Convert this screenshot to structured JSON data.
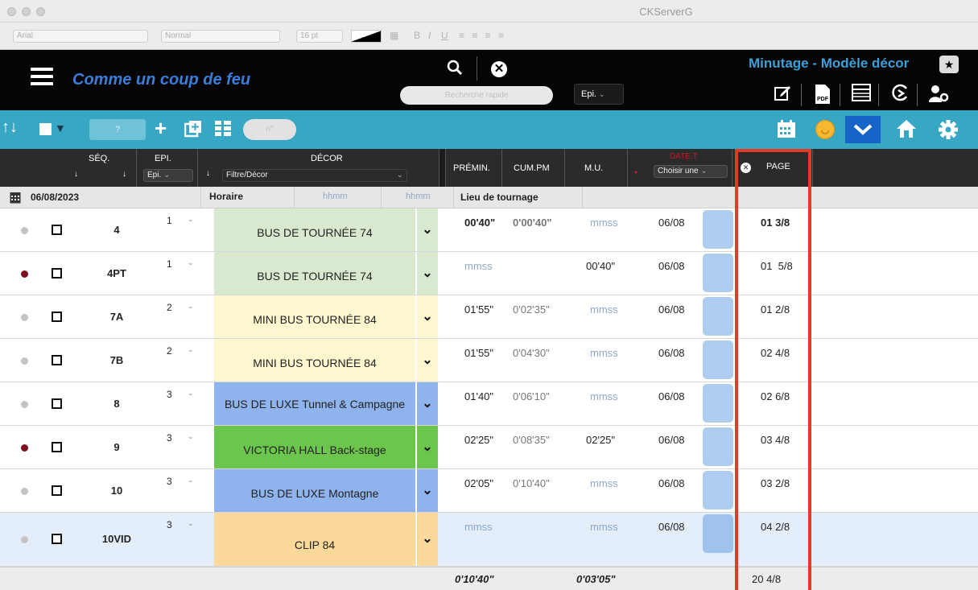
{
  "window": {
    "title": "CKServerG"
  },
  "format_bar": {
    "font": "Arial",
    "style": "Normal",
    "size": "16 pt",
    "bold": "B",
    "italic": "I",
    "underline": "U",
    "align_glyphs": "≡ ≡ ≡ ≡"
  },
  "header": {
    "app_title": "Comme un coup de feu",
    "search_placeholder": "Recherche rapide",
    "epi_select": "Epi.",
    "minutage_title": "Minutage - Modèle décor",
    "icons": [
      "edit-icon",
      "pdf-icon",
      "table-icon",
      "search-refresh-icon",
      "user-settings-icon"
    ],
    "pdf_label": "PDF"
  },
  "toolbar": {
    "number_input": "?",
    "pill_placeholder": "n°",
    "colors": {
      "bar": "#37a7c4",
      "accent_button": "#1664c8"
    }
  },
  "columns": {
    "seq": "SÉQ.",
    "epi": "EPI.",
    "epi_select": "Epi.",
    "decor": "DÉCOR",
    "decor_filter": "Filtre/Décor",
    "premin": "PRÉMIN.",
    "cumpm": "CUM.PM",
    "mu": "M.U.",
    "datet": "DATE.T",
    "datet_select": "Choisir une",
    "page": "PAGE"
  },
  "date_row": {
    "date": "06/08/2023",
    "horaire": "Horaire",
    "hhmm1": "hhmm",
    "hhmm2": "hhmm",
    "lieu": "Lieu de tournage"
  },
  "rows": [
    {
      "seq": "4",
      "epi": "1",
      "decor": "BUS DE TOURNÉE 74",
      "premin": "00'40\"",
      "cumpm": "0'00'40\"",
      "mu": "mmss",
      "date": "06/08",
      "page": "01 3/8"
    },
    {
      "seq": "4PT",
      "epi": "1",
      "decor": "BUS DE TOURNÉE 74",
      "premin": "mmss",
      "cumpm": "",
      "mu": "00'40\"",
      "date": "06/08",
      "page": "01  5/8"
    },
    {
      "seq": "7A",
      "epi": "2",
      "decor": "MINI BUS TOURNÉE 84",
      "premin": "01'55\"",
      "cumpm": "0'02'35\"",
      "mu": "mmss",
      "date": "06/08",
      "page": "01 2/8"
    },
    {
      "seq": "7B",
      "epi": "2",
      "decor": "MINI BUS TOURNÉE 84",
      "premin": "01'55\"",
      "cumpm": "0'04'30\"",
      "mu": "mmss",
      "date": "06/08",
      "page": "02 4/8"
    },
    {
      "seq": "8",
      "epi": "3",
      "decor": "BUS DE LUXE Tunnel & Campagne",
      "premin": "01'40\"",
      "cumpm": "0'06'10\"",
      "mu": "mmss",
      "date": "06/08",
      "page": "02 6/8"
    },
    {
      "seq": "9",
      "epi": "3",
      "decor": "VICTORIA HALL Back-stage",
      "premin": "02'25\"",
      "cumpm": "0'08'35\"",
      "mu": "02'25\"",
      "date": "06/08",
      "page": "03 4/8"
    },
    {
      "seq": "10",
      "epi": "3",
      "decor": "BUS DE LUXE Montagne",
      "premin": "02'05\"",
      "cumpm": "0'10'40\"",
      "mu": "mmss",
      "date": "06/08",
      "page": "03 2/8"
    },
    {
      "seq": "10VID",
      "epi": "3",
      "decor": "CLIP 84",
      "premin": "mmss",
      "cumpm": "",
      "mu": "mmss",
      "date": "06/08",
      "page": "04 2/8"
    }
  ],
  "totals": {
    "premin": "0'10'40\"",
    "mu": "0'03'05\"",
    "page": "20 4/8"
  },
  "decor_colors": {
    "bus_tournee": "#d8e9d0",
    "mini_bus": "#fdf7cf",
    "bus_luxe": "#8fb3ec",
    "victoria": "#6cc54c",
    "clip": "#fbd99b",
    "highlight": "#e23b24"
  }
}
